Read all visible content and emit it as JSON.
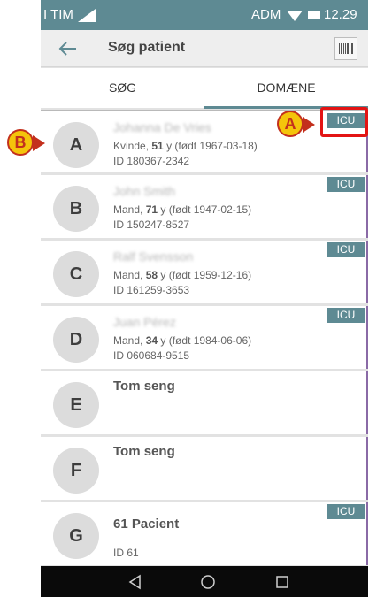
{
  "status_bar": {
    "carrier": "I TIM",
    "network_label": "ADM",
    "time": "12.29"
  },
  "app_bar": {
    "title": "Søg patient",
    "back_icon": "arrow-left-icon",
    "barcode_icon": "barcode-icon"
  },
  "tabs": [
    {
      "label": "SØG",
      "selected": false
    },
    {
      "label": "DOMÆNE",
      "selected": true
    }
  ],
  "patients": [
    {
      "bed": "A",
      "name": "Johanna De Vries",
      "sex": "Kvinde",
      "age": "51",
      "age_suffix": " y (født 1967-03-18)",
      "id": "ID 180367-2342",
      "badge": "ICU"
    },
    {
      "bed": "B",
      "name": "John Smith",
      "sex": "Mand",
      "age": "71",
      "age_suffix": " y (født 1947-02-15)",
      "id": "ID 150247-8527",
      "badge": "ICU"
    },
    {
      "bed": "C",
      "name": "Ralf Svensson",
      "sex": "Mand",
      "age": "58",
      "age_suffix": " y (født 1959-12-16)",
      "id": "ID 161259-3653",
      "badge": "ICU"
    },
    {
      "bed": "D",
      "name": "Juan Pérez",
      "sex": "Mand",
      "age": "34",
      "age_suffix": " y (født 1984-06-06)",
      "id": "ID 060684-9515",
      "badge": "ICU"
    },
    {
      "bed": "E",
      "name": "Tom seng"
    },
    {
      "bed": "F",
      "name": "Tom seng"
    },
    {
      "bed": "G",
      "name": "61 Pacient",
      "id": "ID 61",
      "badge": "ICU"
    }
  ],
  "callouts": {
    "a": "A",
    "b": "B"
  },
  "colors": {
    "accent": "#5e8a93",
    "callout_fill": "#f4c40b",
    "callout_border": "#c3301d",
    "highlight": "#e31414"
  }
}
